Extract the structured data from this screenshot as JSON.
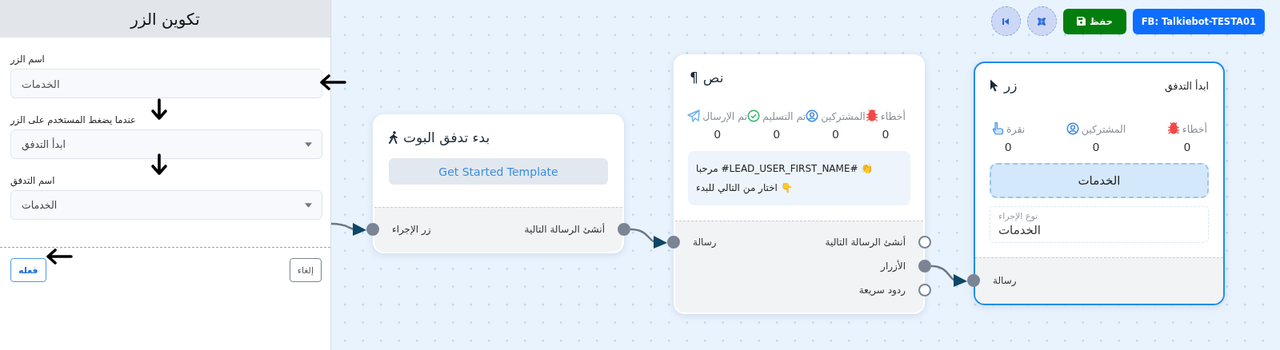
{
  "panel": {
    "title": "تكوين الزر",
    "fields": [
      {
        "kind": "text",
        "label": "اسم الزر",
        "value": "الخدمات"
      },
      {
        "kind": "select",
        "label": "عندما يضغط المستخدم على الزر",
        "value": "ابدأ التدفق"
      },
      {
        "kind": "select",
        "label": "اسم التدفق",
        "value": "الخدمات"
      }
    ],
    "buttons": [
      {
        "kind": "secondary",
        "label": "إلغاء"
      },
      {
        "kind": "primary",
        "label": "فعله"
      }
    ]
  },
  "annotation_arrows": [
    {
      "kind": "left"
    },
    {
      "kind": "down"
    },
    {
      "kind": "down"
    },
    {
      "kind": "left"
    }
  ],
  "toolbar": [
    {
      "kind": "account",
      "label": "FB: Talkiebot-TESTA01"
    },
    {
      "kind": "save",
      "label": "حفظ"
    },
    {
      "kind": "fit"
    },
    {
      "kind": "first"
    }
  ],
  "nodes": [
    {
      "kind": "button",
      "selected": true,
      "title": "زر",
      "subtitle": "ابدأ التدفق",
      "stats": [
        {
          "kind": "errors",
          "label": "أخطاء",
          "value": "0"
        },
        {
          "kind": "subscribers",
          "label": "المشتركين",
          "value": "0"
        },
        {
          "kind": "clicks",
          "label": "نقرة",
          "value": "0"
        }
      ],
      "button_label": "الخدمات",
      "action": {
        "label": "نوع الإجراء",
        "value": "الخدمات"
      },
      "inputs": [
        {
          "label": "رسالة",
          "connected": true
        }
      ]
    },
    {
      "kind": "text",
      "selected": false,
      "title": "نص",
      "icon": "¶",
      "stats": [
        {
          "kind": "errors",
          "label": "أخطاء",
          "value": "0"
        },
        {
          "kind": "subscribers",
          "label": "المشتركين",
          "value": "0"
        },
        {
          "kind": "delivered",
          "label": "تم التسليم",
          "value": "0"
        },
        {
          "kind": "sent",
          "label": "تم الإرسال",
          "value": "0"
        }
      ],
      "message_lines": [
        "مرحبا  #LEAD_USER_FIRST_NAME# 👏",
        "اختار من التالي للبدء 👇"
      ],
      "inputs": [
        {
          "label": "رسالة",
          "connected": true
        }
      ],
      "outputs": [
        {
          "label": "أنشئ الرسالة التالية",
          "connected": false
        },
        {
          "label": "الأزرار",
          "connected": true
        },
        {
          "label": "ردود سريعة",
          "connected": false
        }
      ]
    },
    {
      "kind": "start",
      "selected": false,
      "title": "بدء تدفق البوت",
      "template": "Get Started Template",
      "inputs": [
        {
          "label": "زر الإجراء",
          "connected": true
        }
      ],
      "outputs": [
        {
          "label": "أنشئ الرسالة التالية",
          "connected": true
        }
      ]
    }
  ]
}
